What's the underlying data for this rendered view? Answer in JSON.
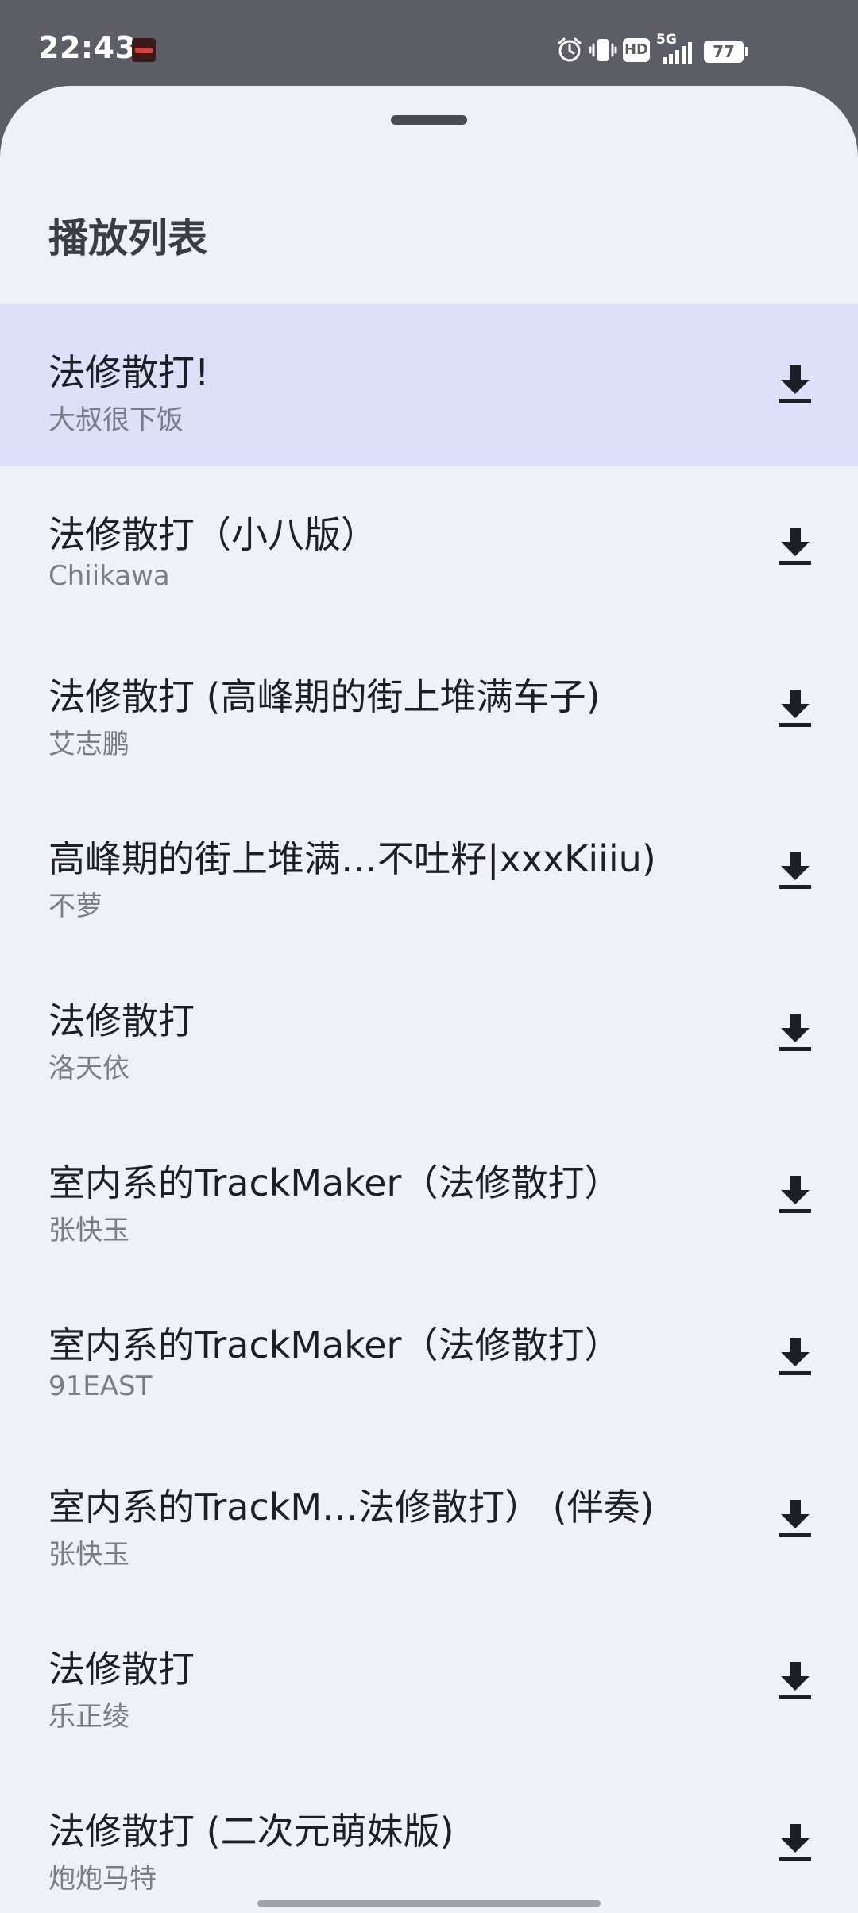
{
  "status_bar": {
    "time": "22:43",
    "network": "5G",
    "hd": "HD",
    "battery": "77"
  },
  "sheet": {
    "title": "播放列表"
  },
  "playlist": [
    {
      "title": "法修散打!",
      "artist": "大叔很下饭",
      "selected": true
    },
    {
      "title": "法修散打（小八版）",
      "artist": "Chiikawa",
      "selected": false
    },
    {
      "title": "法修散打 (高峰期的街上堆满车子)",
      "artist": "艾志鹏",
      "selected": false
    },
    {
      "title": "高峰期的街上堆满…不吐籽|xxxKiiiu)",
      "artist": "不萝",
      "selected": false
    },
    {
      "title": "法修散打",
      "artist": "洛天依",
      "selected": false
    },
    {
      "title": "室内系的TrackMaker（法修散打）",
      "artist": "张快玉",
      "selected": false
    },
    {
      "title": "室内系的TrackMaker（法修散打）",
      "artist": "91EAST",
      "selected": false
    },
    {
      "title": "室内系的TrackM…法修散打） (伴奏)",
      "artist": "张快玉",
      "selected": false
    },
    {
      "title": "法修散打",
      "artist": "乐正绫",
      "selected": false
    },
    {
      "title": "法修散打 (二次元萌妹版)",
      "artist": "炮炮马特",
      "selected": false
    }
  ],
  "icons": {
    "download": "download-icon",
    "alarm": "alarm-icon",
    "vibrate": "vibrate-icon",
    "signal": "signal-icon"
  },
  "colors": {
    "sheet_bg": "#eef0fa",
    "selected_row": "#dbe1f6",
    "status_bar": "#5b5e66"
  }
}
